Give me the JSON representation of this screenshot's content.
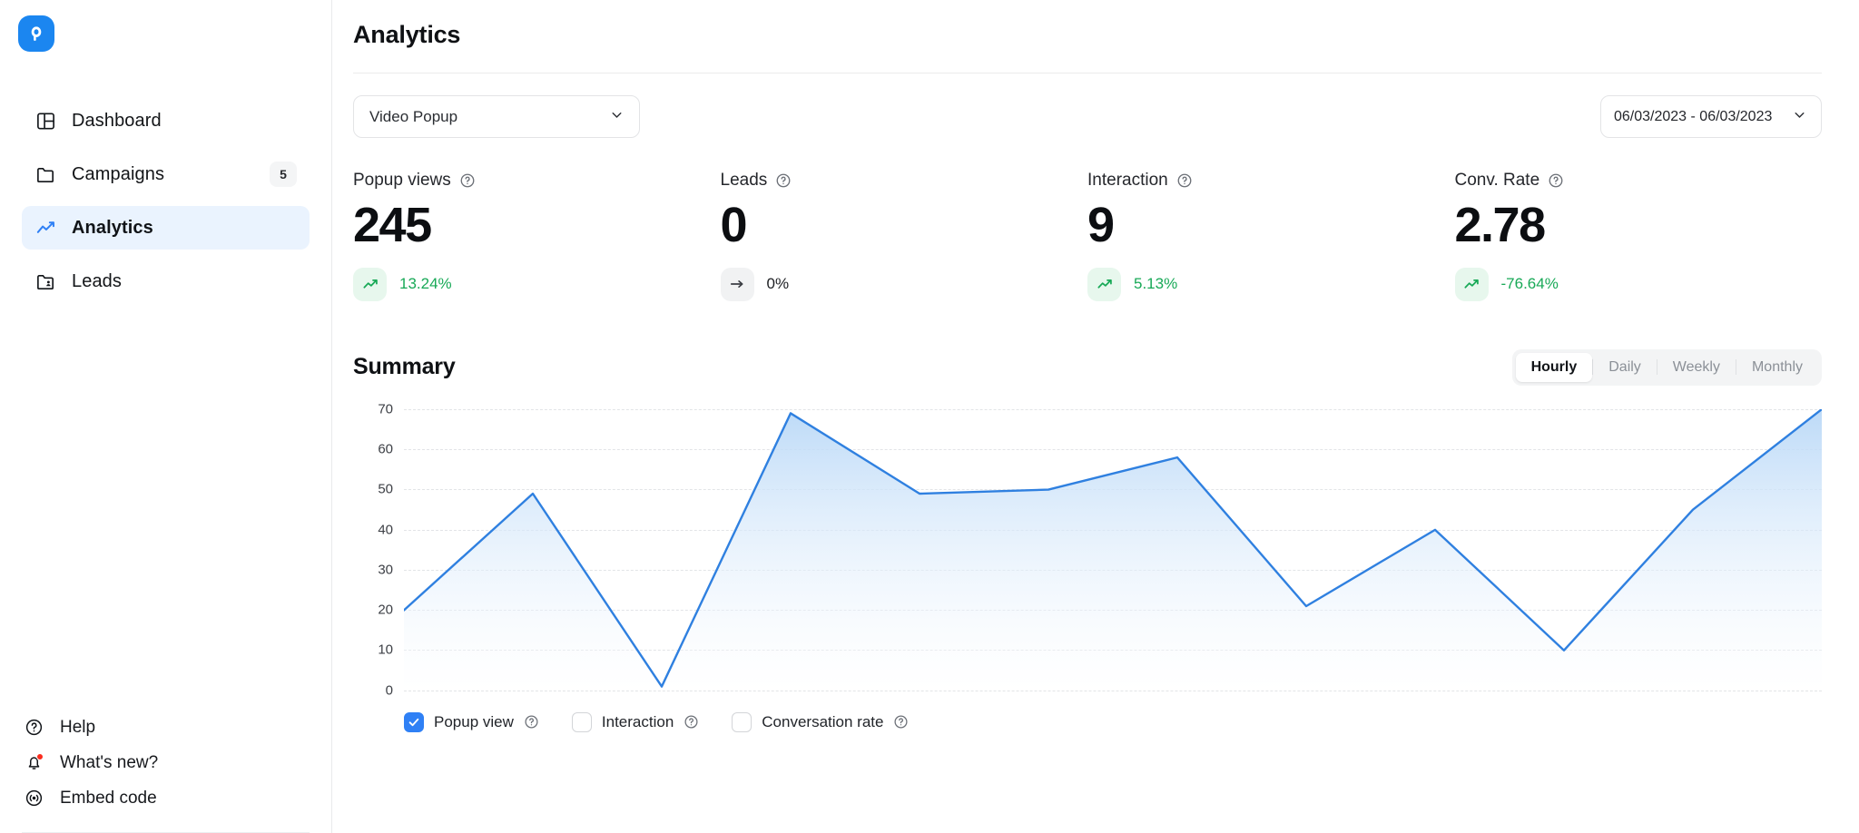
{
  "brand": {
    "logo_icon": "popup-logo-icon"
  },
  "sidebar": {
    "items": [
      {
        "label": "Dashboard",
        "icon": "dashboard-icon",
        "badge": null,
        "active": false
      },
      {
        "label": "Campaigns",
        "icon": "folder-icon",
        "badge": "5",
        "active": false
      },
      {
        "label": "Analytics",
        "icon": "line-chart-icon",
        "badge": null,
        "active": true
      },
      {
        "label": "Leads",
        "icon": "folder-user-icon",
        "badge": null,
        "active": false
      }
    ],
    "bottom_items": [
      {
        "label": "Help",
        "icon": "question-circle-icon",
        "has_dot": false
      },
      {
        "label": "What's new?",
        "icon": "bell-icon",
        "has_dot": true
      },
      {
        "label": "Embed code",
        "icon": "broadcast-icon",
        "has_dot": false
      }
    ]
  },
  "header": {
    "title": "Analytics"
  },
  "controls": {
    "campaign_select": {
      "value": "Video Popup",
      "icon": "chevron-down-icon"
    },
    "date_range": {
      "value": "06/03/2023 - 06/03/2023",
      "icon": "chevron-down-icon"
    }
  },
  "kpis": [
    {
      "label": "Popup views",
      "value": "245",
      "delta": "13.24%",
      "trend": "up",
      "info_icon": "question-circle-icon"
    },
    {
      "label": "Leads",
      "value": "0",
      "delta": "0%",
      "trend": "flat",
      "info_icon": "question-circle-icon"
    },
    {
      "label": "Interaction",
      "value": "9",
      "delta": "5.13%",
      "trend": "up",
      "info_icon": "question-circle-icon"
    },
    {
      "label": "Conv. Rate",
      "value": "2.78",
      "delta": "-76.64%",
      "trend": "up",
      "info_icon": "question-circle-icon"
    }
  ],
  "summary": {
    "title": "Summary",
    "periods": [
      {
        "label": "Hourly",
        "active": true
      },
      {
        "label": "Daily",
        "active": false
      },
      {
        "label": "Weekly",
        "active": false
      },
      {
        "label": "Monthly",
        "active": false
      }
    ]
  },
  "legend": [
    {
      "label": "Popup view",
      "checked": true,
      "info_icon": "question-circle-icon"
    },
    {
      "label": "Interaction",
      "checked": false,
      "info_icon": "question-circle-icon"
    },
    {
      "label": "Conversation rate",
      "checked": false,
      "info_icon": "question-circle-icon"
    }
  ],
  "colors": {
    "brand_blue": "#1b86f0",
    "line_blue": "#2f80e0",
    "active_nav_bg": "#eaf3fe",
    "up_green": "#18a957",
    "alert_red": "#fb2c1e"
  },
  "chart_data": {
    "type": "area",
    "title": "Summary",
    "series_name": "Popup view",
    "x": [
      0,
      1,
      2,
      3,
      4,
      5,
      6,
      7,
      8,
      9,
      10,
      11
    ],
    "values": [
      20,
      49,
      1,
      69,
      49,
      50,
      58,
      21,
      40,
      10,
      45,
      70
    ],
    "ylabel": "",
    "xlabel": "",
    "ylim": [
      0,
      70
    ],
    "yticks": [
      0,
      10,
      20,
      30,
      40,
      50,
      60,
      70
    ],
    "grid": true,
    "legend_position": "bottom",
    "line_color": "#2f80e0",
    "fill_gradient": [
      "#b9d8f7",
      "#ffffff"
    ]
  }
}
